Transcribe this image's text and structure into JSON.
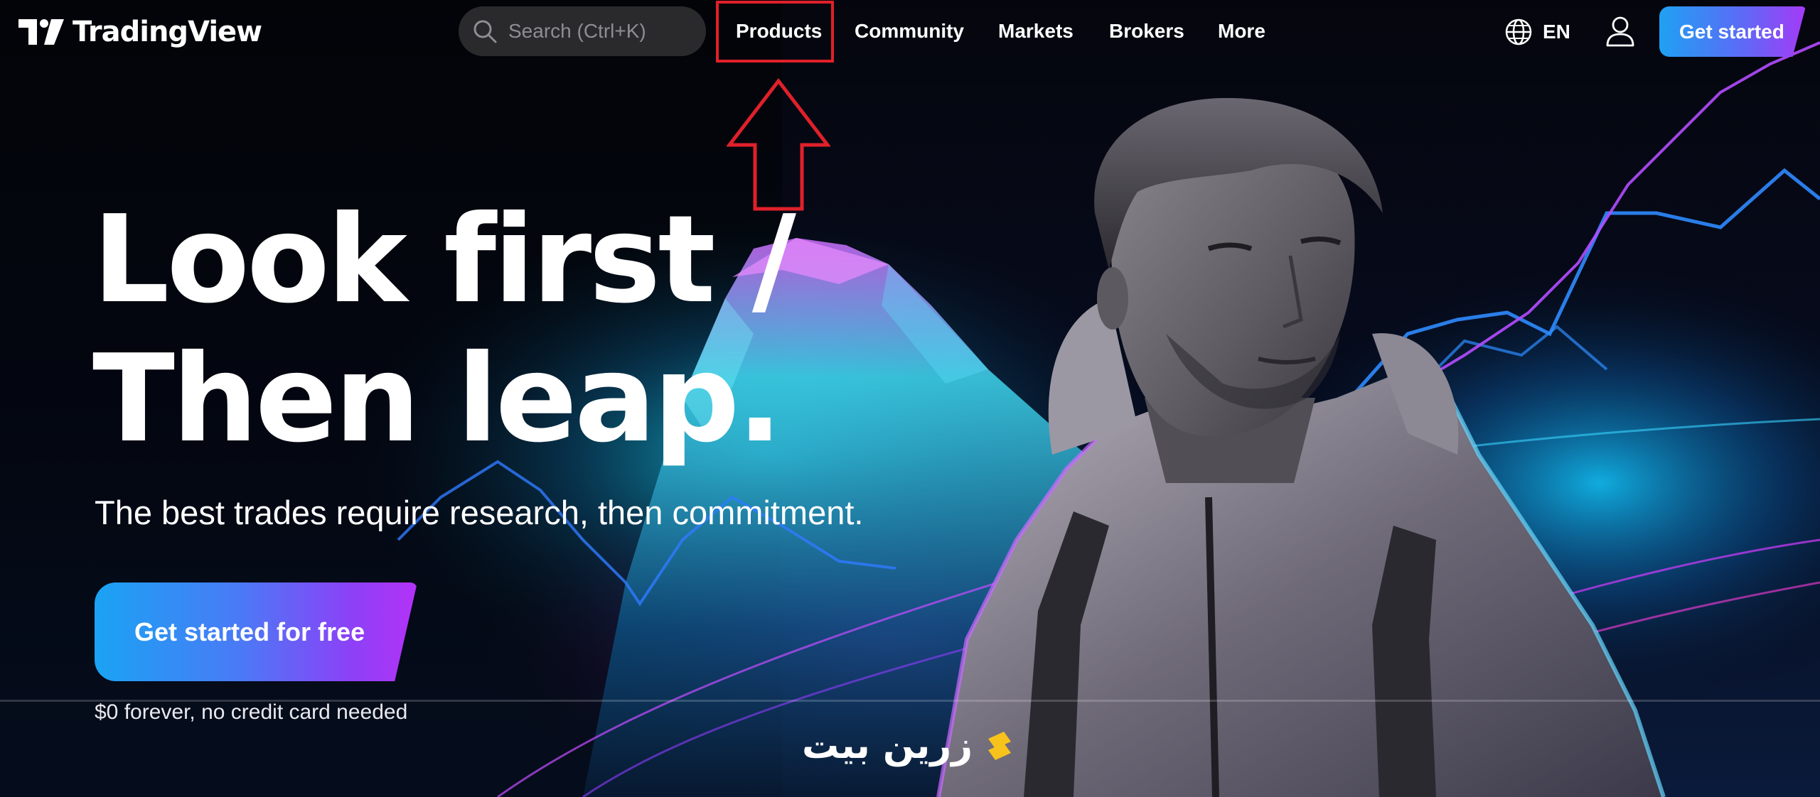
{
  "header": {
    "brand_name": "TradingView",
    "search_placeholder": "Search (Ctrl+K)",
    "nav": [
      {
        "label": "Products",
        "highlighted": true
      },
      {
        "label": "Community"
      },
      {
        "label": "Markets"
      },
      {
        "label": "Brokers"
      },
      {
        "label": "More"
      }
    ],
    "language": "EN",
    "cta_label": "Get started"
  },
  "hero": {
    "headline_line1": "Look first /",
    "headline_line2": "Then leap.",
    "subheading": "The best trades require research, then commitment.",
    "cta_label": "Get started for free",
    "note": "$0 forever, no credit card needed"
  },
  "watermark": {
    "text": "زرین بیت"
  },
  "icons": {
    "logo": "tradingview-logo-icon",
    "search": "search-icon",
    "language": "globe-icon",
    "account": "user-icon",
    "annotation": "arrow-up-icon"
  },
  "colors": {
    "background": "#03040a",
    "accent_blue": "#1fa1f3",
    "accent_purple": "#a53af7",
    "annotation_red": "#e0202a",
    "search_bg": "#2a2a2d"
  }
}
